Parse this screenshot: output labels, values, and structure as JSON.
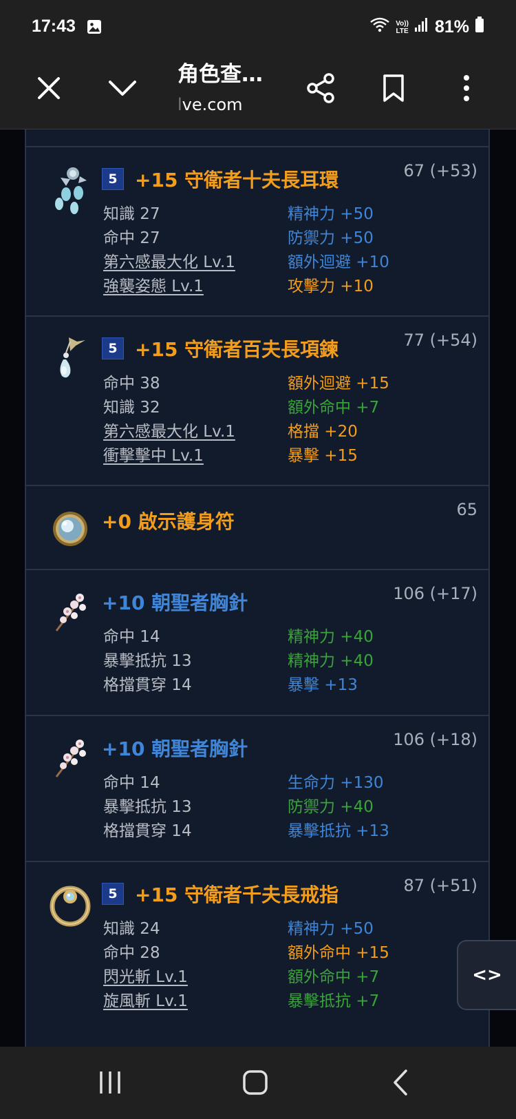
{
  "status_bar": {
    "time": "17:43",
    "lte_top": "Vo))",
    "lte_bottom": "LTE",
    "battery": "81%"
  },
  "toolbar": {
    "title": "角色查…",
    "url_faded": "l",
    "url": "ve.com"
  },
  "items": [
    {
      "tier": "5",
      "name": "+15 守衛者十夫長耳環",
      "name_color": "orange",
      "score": "67 (+53)",
      "icon": "earring-icon",
      "stats": [
        {
          "left": "知識 27",
          "left_link": false,
          "right": "精神力 +50",
          "right_color": "blue"
        },
        {
          "left": "命中 27",
          "left_link": false,
          "right": "防禦力 +50",
          "right_color": "blue"
        },
        {
          "left": "第六感最大化 Lv.1",
          "left_link": true,
          "right": "額外迴避 +10",
          "right_color": "blue"
        },
        {
          "left": "強襲姿態 Lv.1",
          "left_link": true,
          "right": "攻擊力 +10",
          "right_color": "orange"
        }
      ]
    },
    {
      "tier": "5",
      "name": "+15 守衛者百夫長項鍊",
      "name_color": "orange",
      "score": "77 (+54)",
      "icon": "necklace-icon",
      "stats": [
        {
          "left": "命中 38",
          "left_link": false,
          "right": "額外迴避 +15",
          "right_color": "orange"
        },
        {
          "left": "知識 32",
          "left_link": false,
          "right": "額外命中 +7",
          "right_color": "green"
        },
        {
          "left": "第六感最大化 Lv.1",
          "left_link": true,
          "right": "格擋 +20",
          "right_color": "orange"
        },
        {
          "left": "衝擊擊中 Lv.1",
          "left_link": true,
          "right": "暴擊 +15",
          "right_color": "orange"
        }
      ]
    },
    {
      "tier": "",
      "name": "+0 啟示護身符",
      "name_color": "orange",
      "score": "65",
      "icon": "amulet-icon",
      "stats": []
    },
    {
      "tier": "",
      "name": "+10 朝聖者胸針",
      "name_color": "blue",
      "score": "106 (+17)",
      "icon": "brooch-icon",
      "stats": [
        {
          "left": "命中 14",
          "left_link": false,
          "right": "精神力 +40",
          "right_color": "green"
        },
        {
          "left": "暴擊抵抗 13",
          "left_link": false,
          "right": "精神力 +40",
          "right_color": "green"
        },
        {
          "left": "格擋貫穿 14",
          "left_link": false,
          "right": "暴擊 +13",
          "right_color": "blue"
        }
      ]
    },
    {
      "tier": "",
      "name": "+10 朝聖者胸針",
      "name_color": "blue",
      "score": "106 (+18)",
      "icon": "brooch-icon",
      "stats": [
        {
          "left": "命中 14",
          "left_link": false,
          "right": "生命力 +130",
          "right_color": "blue"
        },
        {
          "left": "暴擊抵抗 13",
          "left_link": false,
          "right": "防禦力 +40",
          "right_color": "green"
        },
        {
          "left": "格擋貫穿 14",
          "left_link": false,
          "right": "暴擊抵抗 +13",
          "right_color": "blue"
        }
      ]
    },
    {
      "tier": "5",
      "name": "+15 守衛者千夫長戒指",
      "name_color": "orange",
      "score": "87 (+51)",
      "icon": "ring-icon",
      "stats": [
        {
          "left": "知識 24",
          "left_link": false,
          "right": "精神力 +50",
          "right_color": "blue"
        },
        {
          "left": "命中 28",
          "left_link": false,
          "right": "額外命中 +15",
          "right_color": "orange"
        },
        {
          "left": "閃光斬 Lv.1",
          "left_link": true,
          "right": "額外命中 +7",
          "right_color": "green"
        },
        {
          "left": "旋風斬 Lv.1",
          "left_link": true,
          "right": "暴擊抵抗 +7",
          "right_color": "green"
        }
      ]
    }
  ],
  "side_toggle": {
    "label": "<>"
  },
  "colors": {
    "orange": "#f39d1c",
    "blue": "#3f86d8",
    "green": "#3aa43a",
    "panel": "#121b2b"
  }
}
